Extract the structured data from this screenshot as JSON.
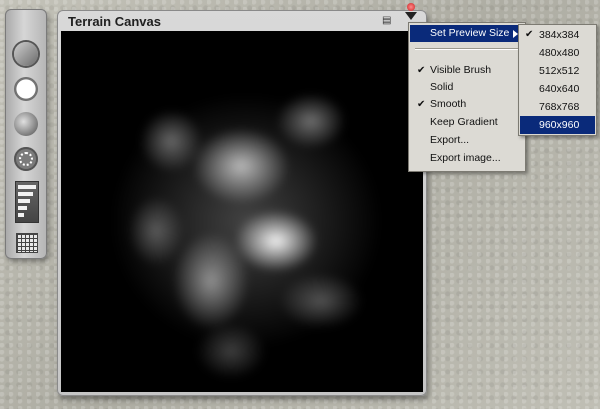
{
  "window": {
    "title": "Terrain Canvas"
  },
  "toolbar": {
    "tools": [
      "brush-tool-icon",
      "solid-circle-icon",
      "soft-circle-icon",
      "dotted-circle-icon",
      "gradient-levels-icon",
      "grid-icon"
    ]
  },
  "menu": {
    "items": [
      {
        "label": "Set Preview Size",
        "checked": false,
        "highlighted": true,
        "submenu": true
      },
      {
        "label": "Visible Brush",
        "checked": true
      },
      {
        "label": "Solid",
        "checked": false
      },
      {
        "label": "Smooth",
        "checked": true
      },
      {
        "label": "Keep Gradient",
        "checked": false
      },
      {
        "label": "Export...",
        "checked": false
      },
      {
        "label": "Export image...",
        "checked": false
      }
    ]
  },
  "submenu": {
    "items": [
      {
        "label": "384x384",
        "checked": true
      },
      {
        "label": "480x480",
        "checked": false
      },
      {
        "label": "512x512",
        "checked": false
      },
      {
        "label": "640x640",
        "checked": false
      },
      {
        "label": "768x768",
        "checked": false
      },
      {
        "label": "960x960",
        "checked": false,
        "highlighted": true
      }
    ]
  },
  "check_glyph": "✔",
  "colors": {
    "menu_highlight": "#0a2a7a",
    "menu_bg": "#dcdad4",
    "canvas_bg": "#000000"
  }
}
